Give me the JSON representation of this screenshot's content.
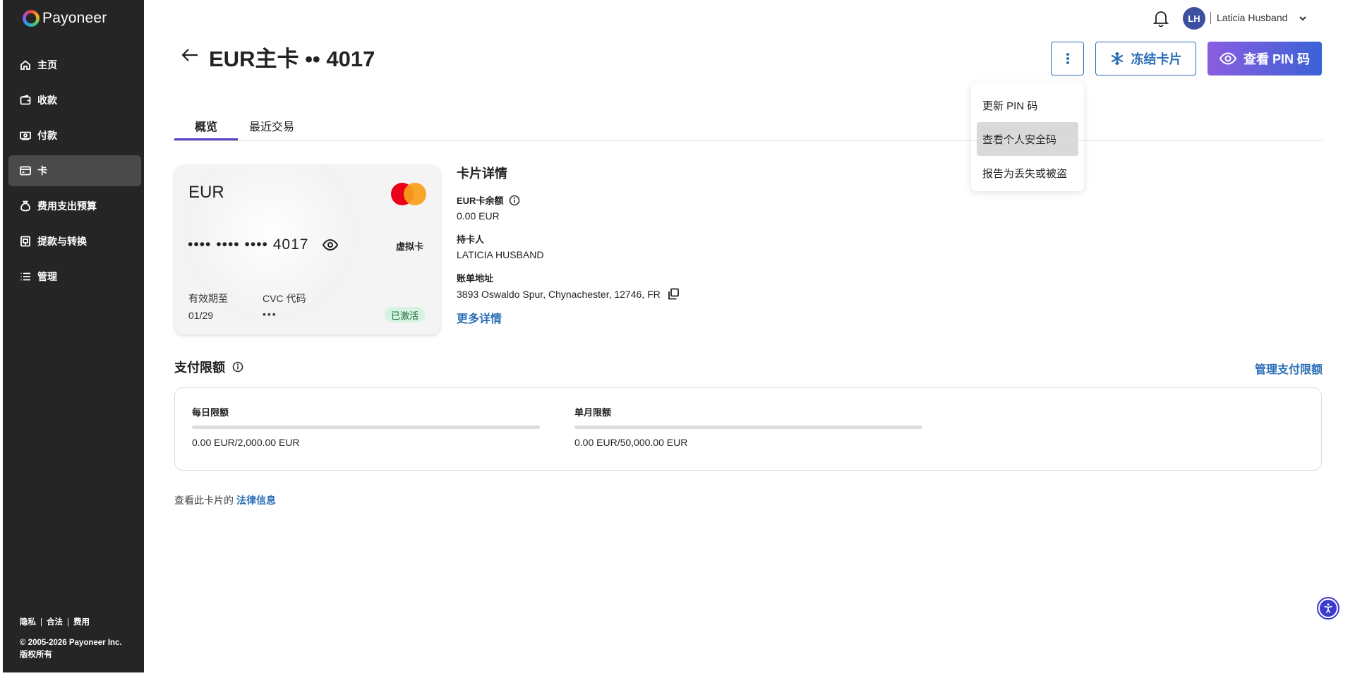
{
  "brand": {
    "name": "Payoneer"
  },
  "sidebar": {
    "items": [
      {
        "label": "主页",
        "icon": "home-icon"
      },
      {
        "label": "收款",
        "icon": "wallet-icon"
      },
      {
        "label": "付款",
        "icon": "payment-icon"
      },
      {
        "label": "卡",
        "icon": "card-icon",
        "active": true
      },
      {
        "label": "费用支出预算",
        "icon": "budget-icon"
      },
      {
        "label": "提款与转换",
        "icon": "withdraw-icon"
      },
      {
        "label": "管理",
        "icon": "list-icon"
      }
    ],
    "footer": {
      "links": [
        "隐私",
        "合法",
        "费用"
      ],
      "separator": "|",
      "copyright": "© 2005-2026 Payoneer Inc.",
      "rights": "版权所有"
    }
  },
  "topbar": {
    "avatar_initials": "LH",
    "user_name": "Laticia Husband"
  },
  "header": {
    "title": "EUR主卡 •• 4017",
    "freeze_label": "冻结卡片",
    "view_pin_label": "查看 PIN 码"
  },
  "menu": {
    "items": [
      "更新 PIN 码",
      "查看个人安全码",
      "报告为丢失或被盗"
    ],
    "hovered_index": 1
  },
  "tabs": [
    {
      "label": "概览",
      "active": true
    },
    {
      "label": "最近交易",
      "active": false
    }
  ],
  "card": {
    "currency": "EUR",
    "masked_number": "•••• •••• •••• 4017",
    "type_label": "虚拟卡",
    "expiry_label": "有效期至",
    "expiry": "01/29",
    "cvc_label": "CVC 代码",
    "cvc": "•••",
    "status": "已激活"
  },
  "details": {
    "title": "卡片详情",
    "balance_label": "EUR卡余额",
    "balance": "0.00 EUR",
    "holder_label": "持卡人",
    "holder": "LATICIA HUSBAND",
    "address_label": "账单地址",
    "address": "3893 Oswaldo Spur, Chynachester, 12746, FR",
    "more_link": "更多详情"
  },
  "limits": {
    "title": "支付限额",
    "manage_link": "管理支付限额",
    "daily_label": "每日限额",
    "daily_value": "0.00 EUR/2,000.00 EUR",
    "daily_used_fraction": 0,
    "monthly_label": "单月限额",
    "monthly_value": "0.00 EUR/50,000.00 EUR",
    "monthly_used_fraction": 0
  },
  "legal": {
    "text": "查看此卡片的",
    "link": "法律信息"
  },
  "colors": {
    "accent_blue": "#2a6fb6",
    "accent_purple": "#5b3fc7",
    "sidebar_bg": "#252525",
    "status_green_bg": "#d6f2e0"
  }
}
